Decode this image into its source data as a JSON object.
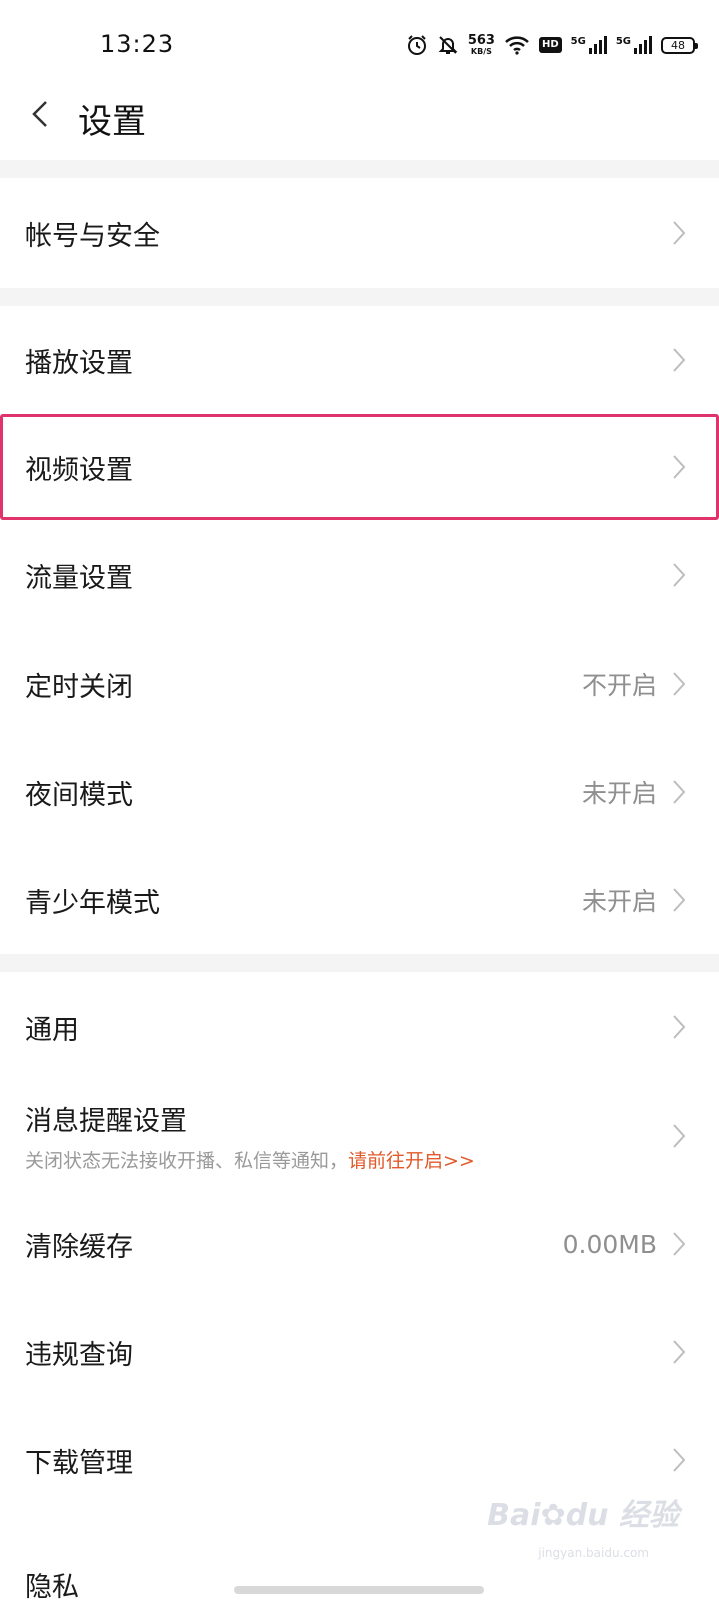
{
  "status_bar": {
    "time": "13:23",
    "net_speed_value": "563",
    "net_speed_unit": "KB/S",
    "hd_label": "HD",
    "signal1_gen": "5G",
    "signal2_gen": "5G",
    "battery": "48"
  },
  "header": {
    "title": "设置"
  },
  "sections": {
    "account": {
      "label": "帐号与安全"
    },
    "playback": {
      "label": "播放设置"
    },
    "video": {
      "label": "视频设置"
    },
    "traffic": {
      "label": "流量设置"
    },
    "timer": {
      "label": "定时关闭",
      "value": "不开启"
    },
    "night": {
      "label": "夜间模式",
      "value": "未开启"
    },
    "teen": {
      "label": "青少年模式",
      "value": "未开启"
    },
    "general": {
      "label": "通用"
    },
    "notify": {
      "label": "消息提醒设置",
      "sub": "关闭状态无法接收开播、私信等通知，",
      "link": "请前往开启>>"
    },
    "cache": {
      "label": "清除缓存",
      "value": "0.00MB"
    },
    "violation": {
      "label": "违规查询"
    },
    "download": {
      "label": "下载管理"
    },
    "privacy": {
      "label": "隐私"
    }
  },
  "watermark": {
    "text": "Bai",
    "text2": "du",
    "text3": "经验",
    "sub": "jingyan.baidu.com"
  },
  "colors": {
    "highlight": "#e0336b",
    "link": "#e25a2a",
    "value": "#8f8f8f"
  }
}
